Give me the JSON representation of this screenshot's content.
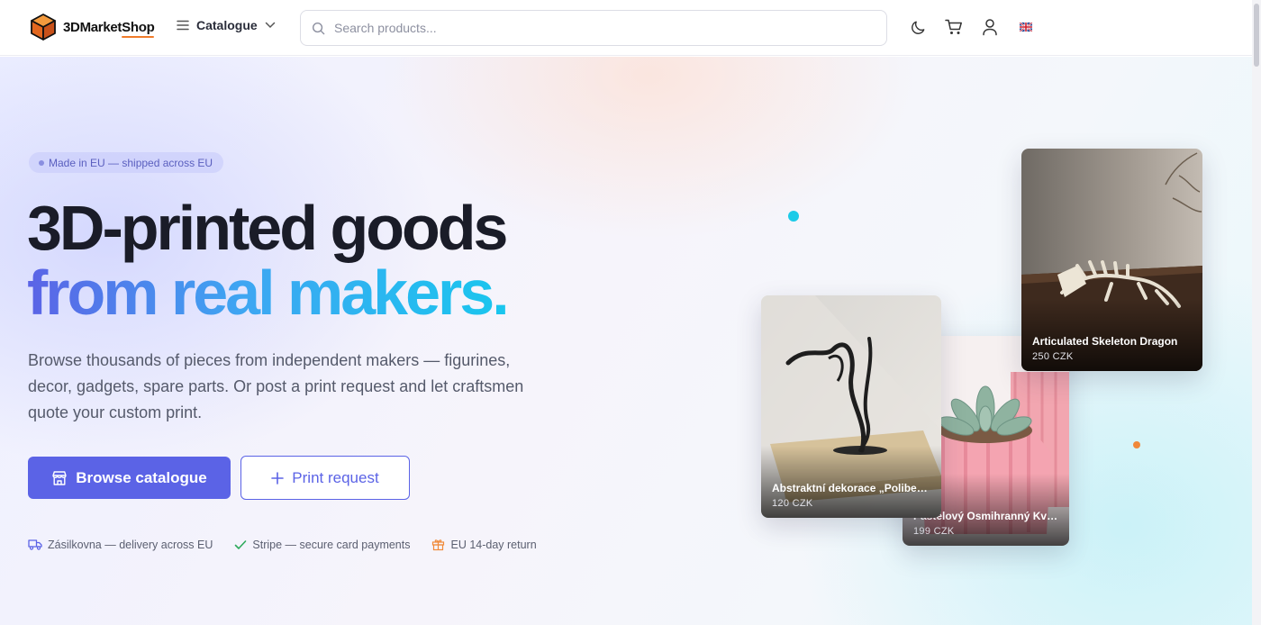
{
  "header": {
    "logo_prefix": "3DMarket",
    "logo_suffix": "Shop",
    "catalogue_label": "Catalogue",
    "search_placeholder": "Search products...",
    "icons": [
      "menu-icon",
      "chevron-down-icon",
      "search-icon",
      "moon-icon",
      "cart-icon",
      "user-icon",
      "uk-flag-icon"
    ]
  },
  "hero": {
    "badge": "Made in EU — shipped across EU",
    "headline_line1": "3D-printed goods",
    "headline_line2": "from real makers.",
    "lead": "Browse thousands of pieces from independent makers — figurines, decor, gadgets, spare parts. Or post a print request and let craftsmen quote your custom print.",
    "primary_button": "Browse catalogue",
    "secondary_button": "Print request",
    "features": [
      {
        "icon": "truck-icon",
        "label": "Zásilkovna — delivery across EU"
      },
      {
        "icon": "check-icon",
        "label": "Stripe — secure card payments"
      },
      {
        "icon": "gift-icon",
        "label": "EU 14-day return"
      }
    ]
  },
  "products": [
    {
      "name": "Articulated Skeleton Dragon",
      "price": "250 CZK"
    },
    {
      "name": "Abstraktní dekorace „Polibek...",
      "price": "120 CZK"
    },
    {
      "name": "Pastelový Osmihranný Květi...",
      "price": "199 CZK"
    }
  ],
  "colors": {
    "accent": "#5b63e6",
    "gradient_start": "#5b63e6",
    "gradient_end": "#19c6ee",
    "logo_underline": "#f07b2a",
    "dot_cyan": "#1ccbe8",
    "dot_orange": "#f0883a"
  }
}
